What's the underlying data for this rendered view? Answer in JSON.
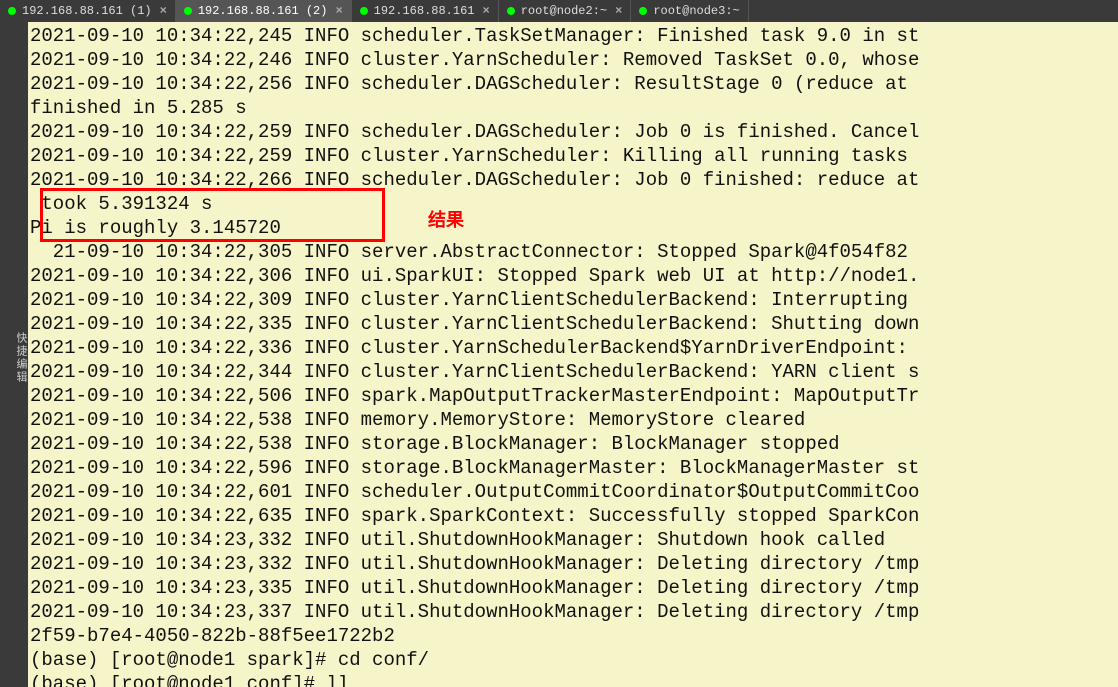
{
  "tabs": [
    {
      "label": "192.168.88.161 (1)"
    },
    {
      "label": "192.168.88.161 (2)"
    },
    {
      "label": "192.168.88.161"
    },
    {
      "label": "root@node2:~"
    },
    {
      "label": "root@node3:~"
    }
  ],
  "activeTabIndex": 1,
  "sidebar": {
    "label": "快捷编辑"
  },
  "annotation": {
    "label": "结果"
  },
  "terminal": {
    "lines": [
      "2021-09-10 10:34:22,245 INFO scheduler.TaskSetManager: Finished task 9.0 in st",
      "2021-09-10 10:34:22,246 INFO cluster.YarnScheduler: Removed TaskSet 0.0, whose",
      "2021-09-10 10:34:22,256 INFO scheduler.DAGScheduler: ResultStage 0 (reduce at ",
      "finished in 5.285 s",
      "2021-09-10 10:34:22,259 INFO scheduler.DAGScheduler: Job 0 is finished. Cancel",
      "2021-09-10 10:34:22,259 INFO cluster.YarnScheduler: Killing all running tasks ",
      "2021-09-10 10:34:22,266 INFO scheduler.DAGScheduler: Job 0 finished: reduce at",
      " took 5.391324 s",
      "Pi is roughly 3.145720",
      "  21-09-10 10:34:22,305 INFO server.AbstractConnector: Stopped Spark@4f054f82 ",
      "2021-09-10 10:34:22,306 INFO ui.SparkUI: Stopped Spark web UI at http://node1.",
      "2021-09-10 10:34:22,309 INFO cluster.YarnClientSchedulerBackend: Interrupting ",
      "2021-09-10 10:34:22,335 INFO cluster.YarnClientSchedulerBackend: Shutting down",
      "2021-09-10 10:34:22,336 INFO cluster.YarnSchedulerBackend$YarnDriverEndpoint: ",
      "2021-09-10 10:34:22,344 INFO cluster.YarnClientSchedulerBackend: YARN client s",
      "2021-09-10 10:34:22,506 INFO spark.MapOutputTrackerMasterEndpoint: MapOutputTr",
      "2021-09-10 10:34:22,538 INFO memory.MemoryStore: MemoryStore cleared",
      "2021-09-10 10:34:22,538 INFO storage.BlockManager: BlockManager stopped",
      "2021-09-10 10:34:22,596 INFO storage.BlockManagerMaster: BlockManagerMaster st",
      "2021-09-10 10:34:22,601 INFO scheduler.OutputCommitCoordinator$OutputCommitCoo",
      "2021-09-10 10:34:22,635 INFO spark.SparkContext: Successfully stopped SparkCon",
      "2021-09-10 10:34:23,332 INFO util.ShutdownHookManager: Shutdown hook called",
      "2021-09-10 10:34:23,332 INFO util.ShutdownHookManager: Deleting directory /tmp",
      "2021-09-10 10:34:23,335 INFO util.ShutdownHookManager: Deleting directory /tmp",
      "2021-09-10 10:34:23,337 INFO util.ShutdownHookManager: Deleting directory /tmp",
      "2f59-b7e4-4050-822b-88f5ee1722b2",
      "(base) [root@node1 spark]# cd conf/",
      "(base) [root@node1 conf]# ll"
    ]
  }
}
